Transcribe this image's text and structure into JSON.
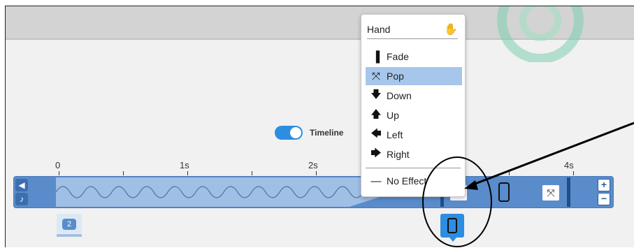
{
  "menu": {
    "header": "Hand",
    "items": [
      {
        "label": "Fade",
        "icon": "fade-icon"
      },
      {
        "label": "Pop",
        "icon": "pop-icon",
        "selected": true
      },
      {
        "label": "Down",
        "icon": "arrow-down-icon"
      },
      {
        "label": "Up",
        "icon": "arrow-up-icon"
      },
      {
        "label": "Left",
        "icon": "arrow-left-icon"
      },
      {
        "label": "Right",
        "icon": "arrow-right-icon"
      }
    ],
    "no_effect": "No Effect"
  },
  "timeline": {
    "toggle_label": "Timeline",
    "toggle_on": true,
    "ticks": [
      "0",
      "1s",
      "2s",
      "4s"
    ]
  },
  "badge": {
    "count": "2"
  },
  "colors": {
    "accent": "#2d8de0",
    "track": "#5a8ccb",
    "selection": "#a6c6ec"
  }
}
